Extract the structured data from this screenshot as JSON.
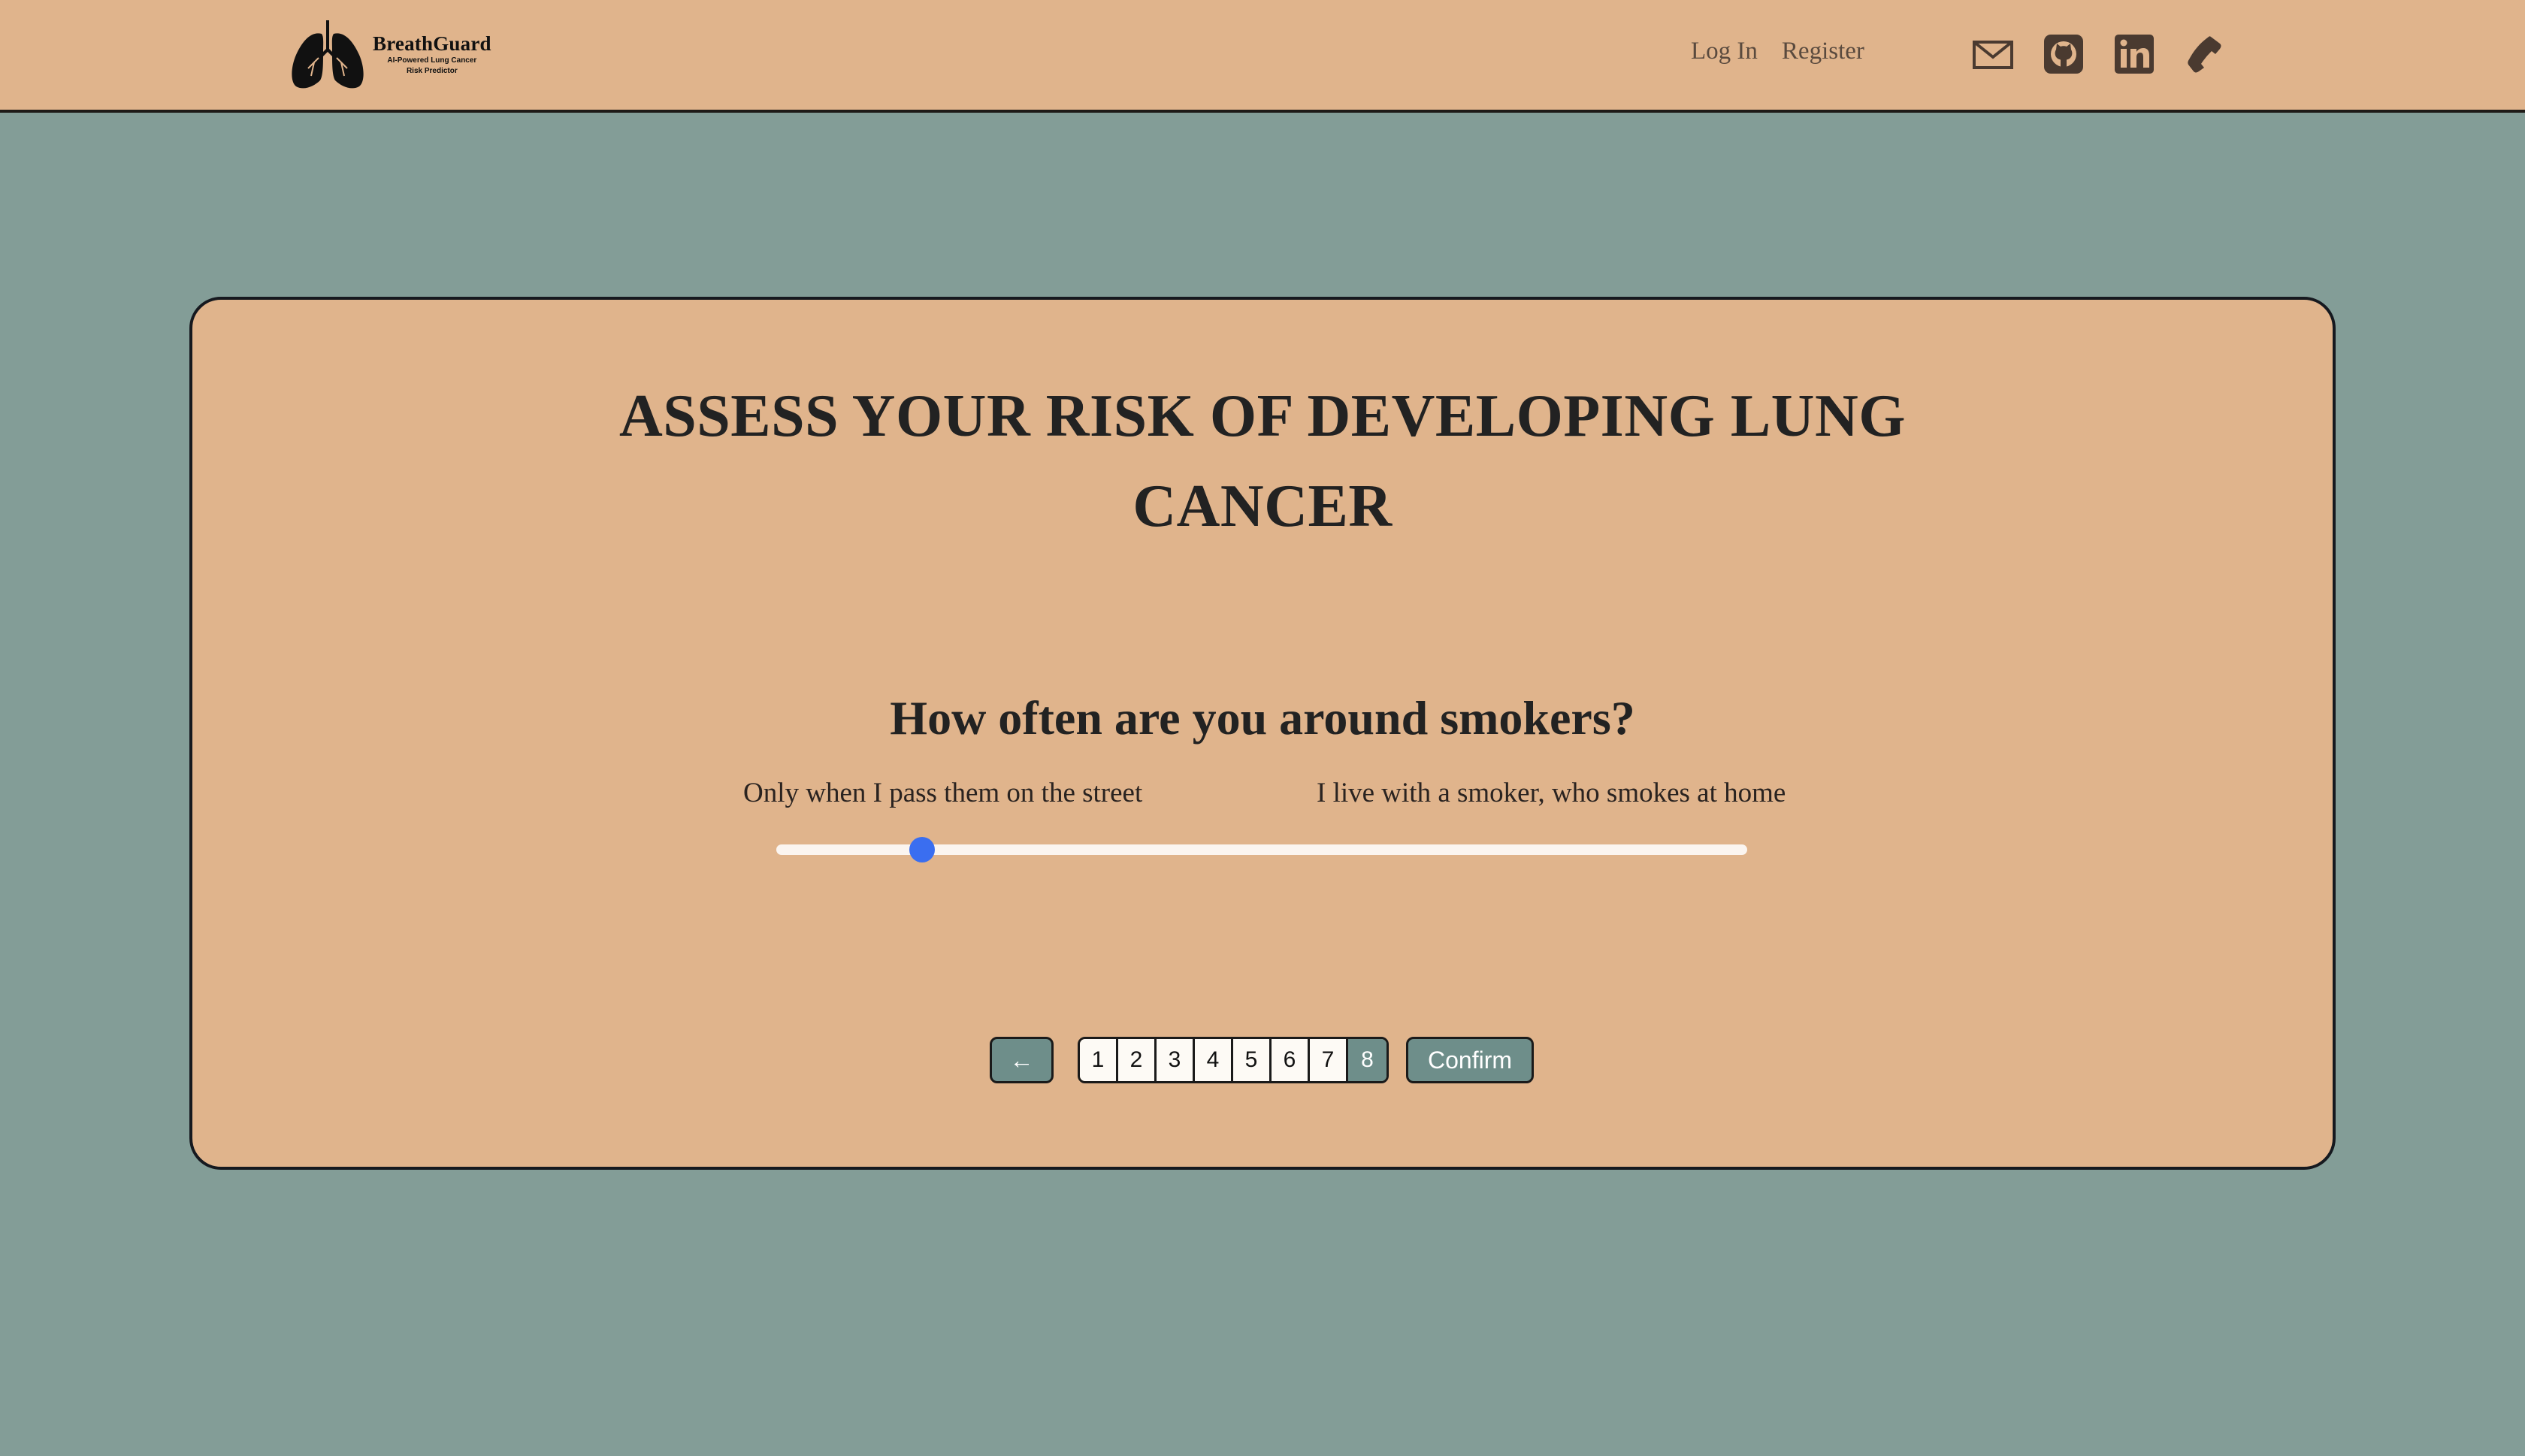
{
  "header": {
    "brand_name": "BreathGuard",
    "brand_tagline_1": "AI-Powered Lung Cancer",
    "brand_tagline_2": "Risk Predictor",
    "nav_links": [
      "Log In",
      "Register"
    ],
    "icons": [
      "mail-icon",
      "github-icon",
      "linkedin-icon",
      "phone-icon"
    ]
  },
  "card": {
    "title": "ASSESS YOUR RISK OF DEVELOPING LUNG CANCER",
    "question": "How often are you around smokers?",
    "slider": {
      "min_label": "Only when I pass them on the street",
      "max_label": "I live with a smoker, who smokes at home",
      "value_fraction": 0.15
    },
    "pager": {
      "back_label": "←",
      "pages": [
        "1",
        "2",
        "3",
        "4",
        "5",
        "6",
        "7",
        "8"
      ],
      "active_page": "8",
      "confirm_label": "Confirm"
    }
  },
  "colors": {
    "background": "#839d97",
    "panel": "#e0b48c",
    "accent": "#6e8e8a",
    "slider_thumb": "#3a6ef0"
  }
}
